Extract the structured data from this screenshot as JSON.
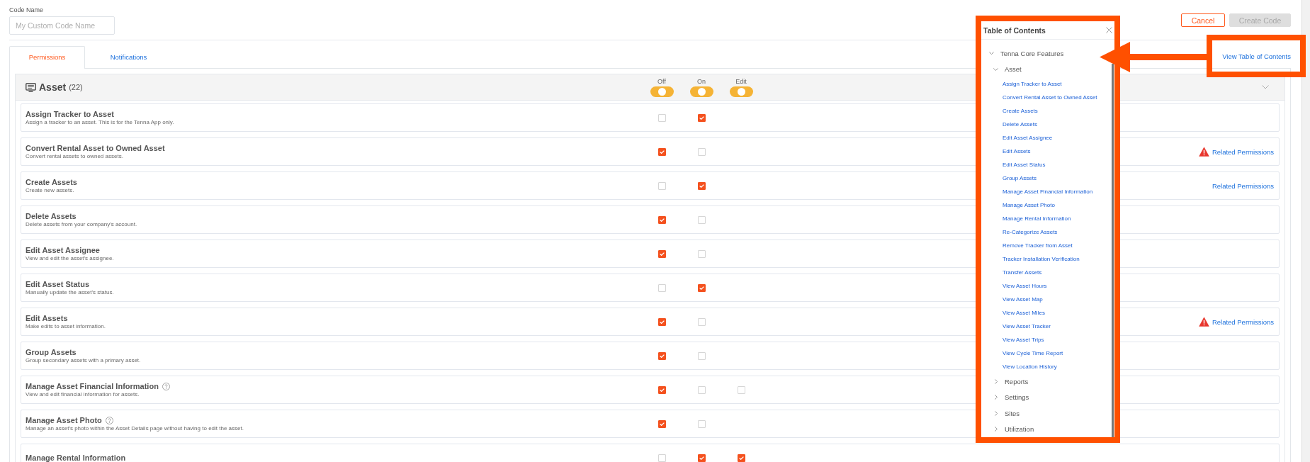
{
  "code_name": {
    "label": "Code Name",
    "placeholder": "My Custom Code Name"
  },
  "actions": [
    {
      "label": "Cancel",
      "kind": "cancel",
      "disabled": false
    },
    {
      "label": "Create Code",
      "kind": "create",
      "disabled": true
    }
  ],
  "tabs": [
    {
      "label": "Permissions",
      "selected": true
    },
    {
      "label": "Notifications",
      "selected": false
    }
  ],
  "view_toc_link": {
    "label": "View Table of Contents",
    "highlighted": true
  },
  "section": {
    "title": "Asset",
    "count": "(22)",
    "expanded": true,
    "columns": [
      {
        "label": "Off",
        "level": 0.5
      },
      {
        "label": "On",
        "level": 0.5
      },
      {
        "label": "Edit",
        "level": 0.5
      }
    ],
    "permissions": [
      {
        "title": "Assign Tracker to Asset",
        "help": false,
        "description": "Assign a tracker to an asset. This is for the Tenna App only.",
        "options": [
          {
            "checked": false
          },
          {
            "checked": true
          }
        ]
      },
      {
        "title": "Convert Rental Asset to Owned Asset",
        "help": false,
        "description": "Convert rental assets to owned assets.",
        "options": [
          {
            "checked": true
          },
          {
            "checked": false
          }
        ],
        "related": {
          "label": "Related Permissions",
          "warning": true
        }
      },
      {
        "title": "Create Assets",
        "help": false,
        "description": "Create new assets.",
        "options": [
          {
            "checked": false
          },
          {
            "checked": true
          }
        ],
        "related": {
          "label": "Related Permissions",
          "warning": false
        }
      },
      {
        "title": "Delete Assets",
        "help": false,
        "description": "Delete assets from your company's account.",
        "options": [
          {
            "checked": true
          },
          {
            "checked": false
          }
        ]
      },
      {
        "title": "Edit Asset Assignee",
        "help": false,
        "description": "View and edit the asset's assignee.",
        "options": [
          {
            "checked": true
          },
          {
            "checked": false
          }
        ]
      },
      {
        "title": "Edit Asset Status",
        "help": false,
        "description": "Manually update the asset's status.",
        "options": [
          {
            "checked": false
          },
          {
            "checked": true
          }
        ]
      },
      {
        "title": "Edit Assets",
        "help": false,
        "description": "Make edits to asset information.",
        "options": [
          {
            "checked": true
          },
          {
            "checked": false
          }
        ],
        "related": {
          "label": "Related Permissions",
          "warning": true
        }
      },
      {
        "title": "Group Assets",
        "help": false,
        "description": "Group secondary assets with a primary asset.",
        "options": [
          {
            "checked": true
          },
          {
            "checked": false
          }
        ]
      },
      {
        "title": "Manage Asset Financial Information",
        "help": true,
        "description": "View and edit financial information for assets.",
        "options": [
          {
            "checked": true
          },
          {
            "checked": false
          },
          {
            "checked": false
          }
        ]
      },
      {
        "title": "Manage Asset Photo",
        "help": true,
        "description": "Manage an asset's photo within the Asset Details page without having to edit the asset.",
        "options": [
          {
            "checked": true
          },
          {
            "checked": false
          }
        ]
      },
      {
        "title": "Manage Rental Information",
        "help": false,
        "options": [
          {
            "checked": false
          },
          {
            "checked": true
          },
          {
            "checked": true
          }
        ]
      }
    ]
  },
  "table_of_contents": {
    "title": "Table of Contents",
    "highlighted": true,
    "items": [
      {
        "label": "Tenna Core Features",
        "expanded": true,
        "children": [
          {
            "label": "Asset",
            "expanded": true,
            "children": [
              {
                "label": "Assign Tracker to Asset"
              },
              {
                "label": "Convert Rental Asset to Owned Asset"
              },
              {
                "label": "Create Assets"
              },
              {
                "label": "Delete Assets"
              },
              {
                "label": "Edit Asset Assignee"
              },
              {
                "label": "Edit Assets"
              },
              {
                "label": "Edit Asset Status"
              },
              {
                "label": "Group Assets"
              },
              {
                "label": "Manage Asset Financial Information"
              },
              {
                "label": "Manage Asset Photo"
              },
              {
                "label": "Manage Rental Information"
              },
              {
                "label": "Re-Categorize Assets"
              },
              {
                "label": "Remove Tracker from Asset"
              },
              {
                "label": "Tracker Installation Verification"
              },
              {
                "label": "Transfer Assets"
              },
              {
                "label": "View Asset Hours"
              },
              {
                "label": "View Asset Map"
              },
              {
                "label": "View Asset Miles"
              },
              {
                "label": "View Asset Tracker"
              },
              {
                "label": "View Asset Trips"
              },
              {
                "label": "View Cycle Time Report"
              },
              {
                "label": "View Location History"
              }
            ]
          },
          {
            "label": "Reports",
            "expanded": false
          },
          {
            "label": "Settings",
            "expanded": false
          },
          {
            "label": "Sites",
            "expanded": false
          },
          {
            "label": "Utilization",
            "expanded": false
          }
        ]
      }
    ]
  }
}
